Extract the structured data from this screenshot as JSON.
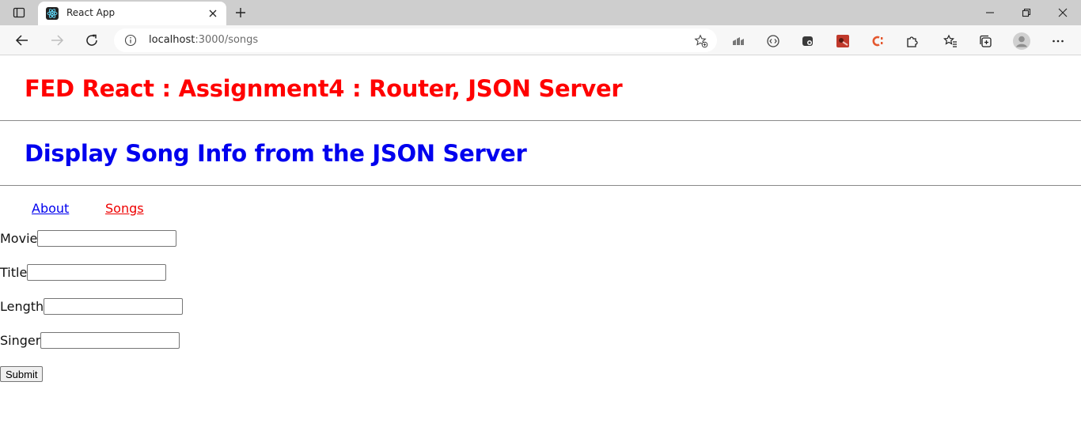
{
  "browser": {
    "tab_title": "React App",
    "url_host": "localhost",
    "url_path": ":3000/songs",
    "icons": [
      "sidebar-icon",
      "react-favicon",
      "close-icon",
      "plus-icon",
      "minimize-icon",
      "restore-icon",
      "window-close-icon",
      "back-icon",
      "forward-icon",
      "reload-icon",
      "info-icon",
      "add-favorite-icon",
      "extension-icon",
      "favorites-icon",
      "collections-icon",
      "profile-icon",
      "more-icon"
    ]
  },
  "page": {
    "title": "FED React : Assignment4 : Router, JSON Server",
    "subtitle": "Display Song Info from the JSON Server",
    "nav": {
      "about": "About",
      "songs": "Songs"
    },
    "form": {
      "movie_label": "Movie",
      "movie_value": "",
      "title_label": "Title",
      "title_value": "",
      "length_label": "Length",
      "length_value": "",
      "singer_label": "Singer",
      "singer_value": "",
      "submit_label": "Submit"
    }
  },
  "colors": {
    "title": "#ff0000",
    "subtitle": "#0000ee",
    "link": "#0000ee",
    "active_link": "#ee0000"
  }
}
